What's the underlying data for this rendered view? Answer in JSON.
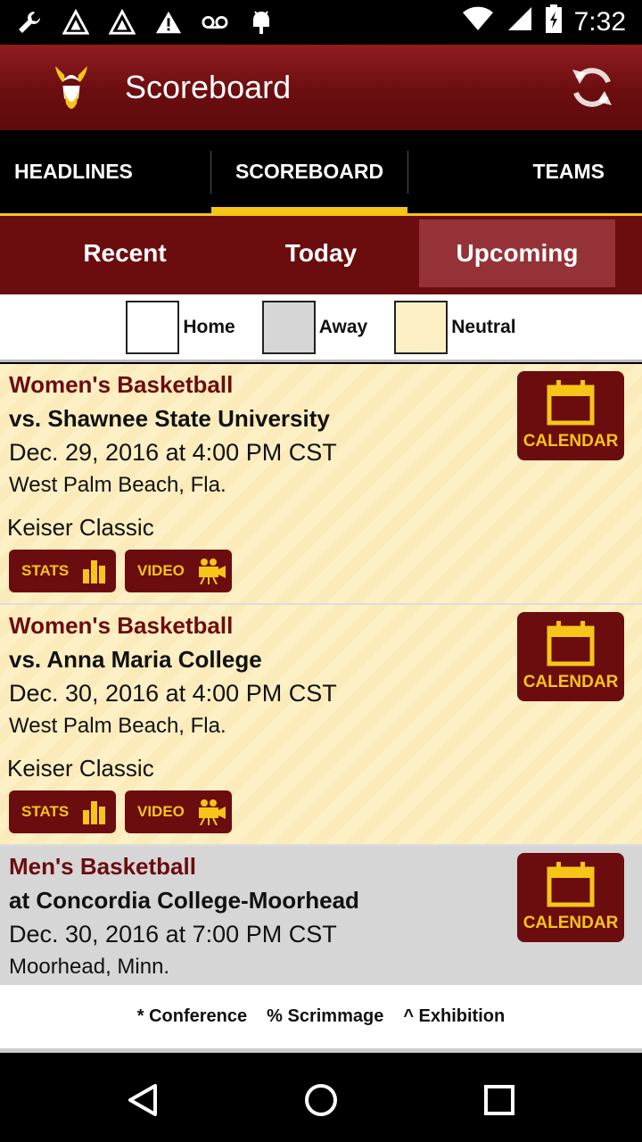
{
  "status_bar": {
    "time": "7:32",
    "left_icons": [
      "wrench-icon",
      "app-icon",
      "app-icon",
      "warning-icon",
      "voicemail-icon",
      "android-icon"
    ],
    "right_icons": [
      "wifi-icon",
      "signal-icon",
      "battery-icon"
    ]
  },
  "app_bar": {
    "title": "Scoreboard",
    "logo_icon": "vikings-logo",
    "refresh_icon": "refresh-icon"
  },
  "tabs": [
    {
      "label": "HEADLINES"
    },
    {
      "label": "SCOREBOARD",
      "active": true
    },
    {
      "label": "TEAMS"
    }
  ],
  "subtabs": [
    {
      "label": "Recent"
    },
    {
      "label": "Today"
    },
    {
      "label": "Upcoming",
      "selected": true
    }
  ],
  "legend": [
    {
      "label": "Home",
      "color": "#ffffff"
    },
    {
      "label": "Away",
      "color": "#d6d6d6"
    },
    {
      "label": "Neutral",
      "color": "#fdf0c4"
    }
  ],
  "games": [
    {
      "sport": "Women's Basketball",
      "opponent": "vs. Shawnee State University",
      "datetime": "Dec. 29, 2016 at 4:00 PM CST",
      "location": "West Palm Beach, Fla.",
      "tournament": "Keiser Classic",
      "calendar_label": "CALENDAR",
      "stats_label": "STATS",
      "video_label": "VIDEO",
      "site": "neutral"
    },
    {
      "sport": "Women's Basketball",
      "opponent": "vs. Anna Maria College",
      "datetime": "Dec. 30, 2016 at 4:00 PM CST",
      "location": "West Palm Beach, Fla.",
      "tournament": "Keiser Classic",
      "calendar_label": "CALENDAR",
      "stats_label": "STATS",
      "video_label": "VIDEO",
      "site": "neutral"
    },
    {
      "sport": "Men's Basketball",
      "opponent": "at Concordia College-Moorhead",
      "datetime": "Dec. 30, 2016 at 7:00 PM CST",
      "location": "Moorhead, Minn.",
      "calendar_label": "CALENDAR",
      "site": "away"
    }
  ],
  "footer": {
    "conference": "* Conference",
    "scrimmage": "% Scrimmage",
    "exhibition": "^ Exhibition"
  },
  "colors": {
    "maroon": "#6b0c0f",
    "gold": "#f5c518"
  }
}
